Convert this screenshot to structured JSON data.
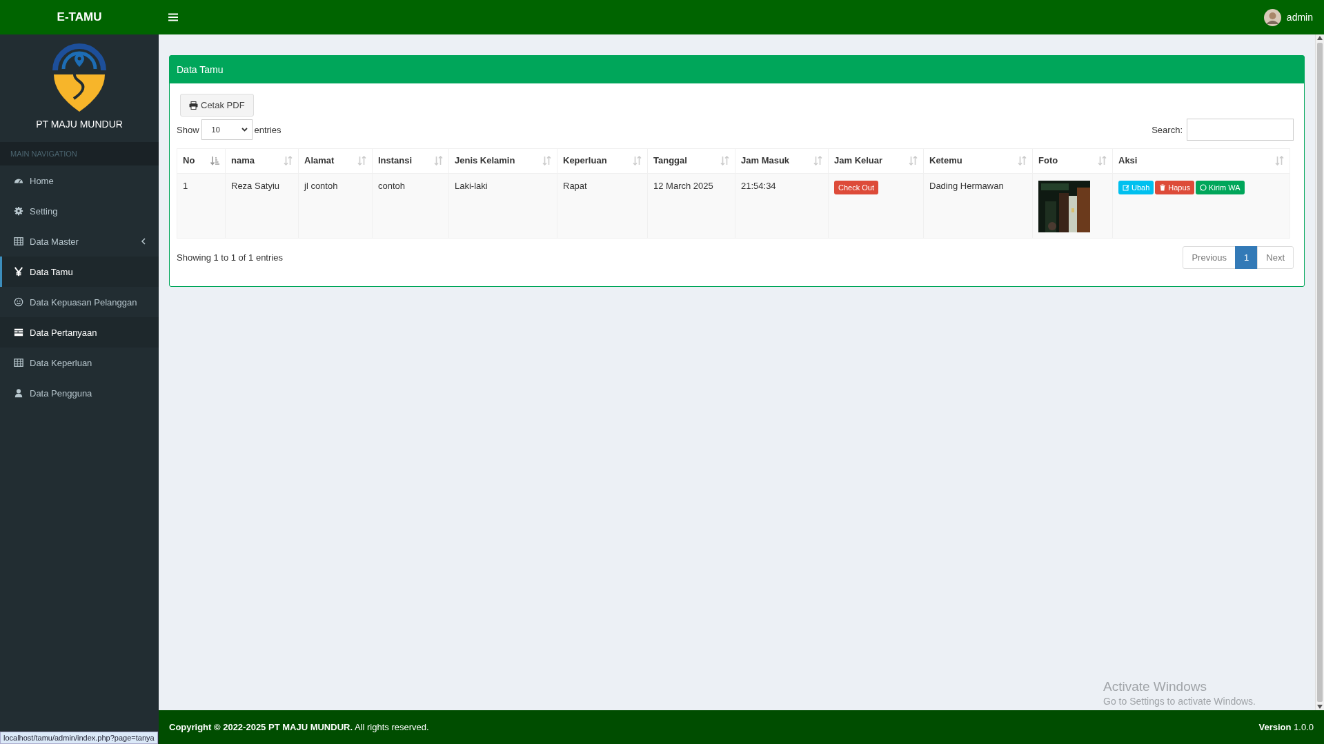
{
  "topbar": {
    "brand": "E-TAMU",
    "user": "admin"
  },
  "sidebar": {
    "company": "PT MAJU MUNDUR",
    "section": "MAIN NAVIGATION",
    "items": [
      {
        "label": "Home",
        "kind": "dashboard",
        "selected": false,
        "hovered": false
      },
      {
        "label": "Setting",
        "kind": "gear",
        "selected": false,
        "hovered": false
      },
      {
        "label": "Data Master",
        "kind": "table",
        "selected": false,
        "hovered": false,
        "expandable": true
      },
      {
        "label": "Data Tamu",
        "kind": "tamu",
        "selected": true,
        "hovered": false
      },
      {
        "label": "Data Kepuasan Pelanggan",
        "kind": "smile",
        "selected": false,
        "hovered": false
      },
      {
        "label": "Data Pertanyaan",
        "kind": "list",
        "selected": false,
        "hovered": true
      },
      {
        "label": "Data Keperluan",
        "kind": "table",
        "selected": false,
        "hovered": false
      },
      {
        "label": "Data Pengguna",
        "kind": "user",
        "selected": false,
        "hovered": false
      }
    ]
  },
  "card": {
    "title": "Data Tamu",
    "print_button": "Cetak PDF",
    "show_label": "Show",
    "page_size": "10",
    "entries_label": "entries",
    "search_label": "Search:",
    "table": {
      "columns": [
        {
          "label": "No",
          "sorted": true
        },
        {
          "label": "nama",
          "sorted": false
        },
        {
          "label": "Alamat",
          "sorted": false
        },
        {
          "label": "Instansi",
          "sorted": false
        },
        {
          "label": "Jenis Kelamin",
          "sorted": false
        },
        {
          "label": "Keperluan",
          "sorted": false
        },
        {
          "label": "Tanggal",
          "sorted": false
        },
        {
          "label": "Jam Masuk",
          "sorted": false
        },
        {
          "label": "Jam Keluar",
          "sorted": false
        },
        {
          "label": "Ketemu",
          "sorted": false
        },
        {
          "label": "Foto",
          "sorted": false
        },
        {
          "label": "Aksi",
          "sorted": false
        }
      ],
      "rows": [
        {
          "cells": [
            {
              "kind": "text",
              "text": "1"
            },
            {
              "kind": "text",
              "text": "Reza Satyiu"
            },
            {
              "kind": "text",
              "text": "jl contoh"
            },
            {
              "kind": "text",
              "text": "contoh"
            },
            {
              "kind": "text",
              "text": "Laki-laki"
            },
            {
              "kind": "text",
              "text": "Rapat"
            },
            {
              "kind": "text",
              "text": "12 March 2025"
            },
            {
              "kind": "text",
              "text": "21:54:34"
            },
            {
              "kind": "checkout",
              "text": "Check Out"
            },
            {
              "kind": "text",
              "text": "Dading Hermawan"
            },
            {
              "kind": "picture"
            },
            {
              "kind": "actions",
              "buttons": [
                {
                  "kind": "edit",
                  "label": "Ubah"
                },
                {
                  "kind": "delete",
                  "label": "Hapus"
                },
                {
                  "kind": "whatsapp",
                  "label": "Kirim WA"
                }
              ]
            }
          ]
        }
      ]
    },
    "info": "Showing 1 to 1 of 1 entries",
    "pagination": [
      {
        "label": "Previous",
        "selected": false
      },
      {
        "label": "1",
        "selected": true
      },
      {
        "label": "Next",
        "selected": false
      }
    ]
  },
  "footer": {
    "copyright": "**Copyright © 2022-2025 PT MAJU MUNDUR.** All rights reserved.",
    "version": "**Version** 1.0.0"
  },
  "os_overlay": {
    "title": "Activate Windows",
    "subtitle": "Go to Settings to activate Windows."
  },
  "status_url": "localhost/tamu/admin/index.php?page=tanya"
}
